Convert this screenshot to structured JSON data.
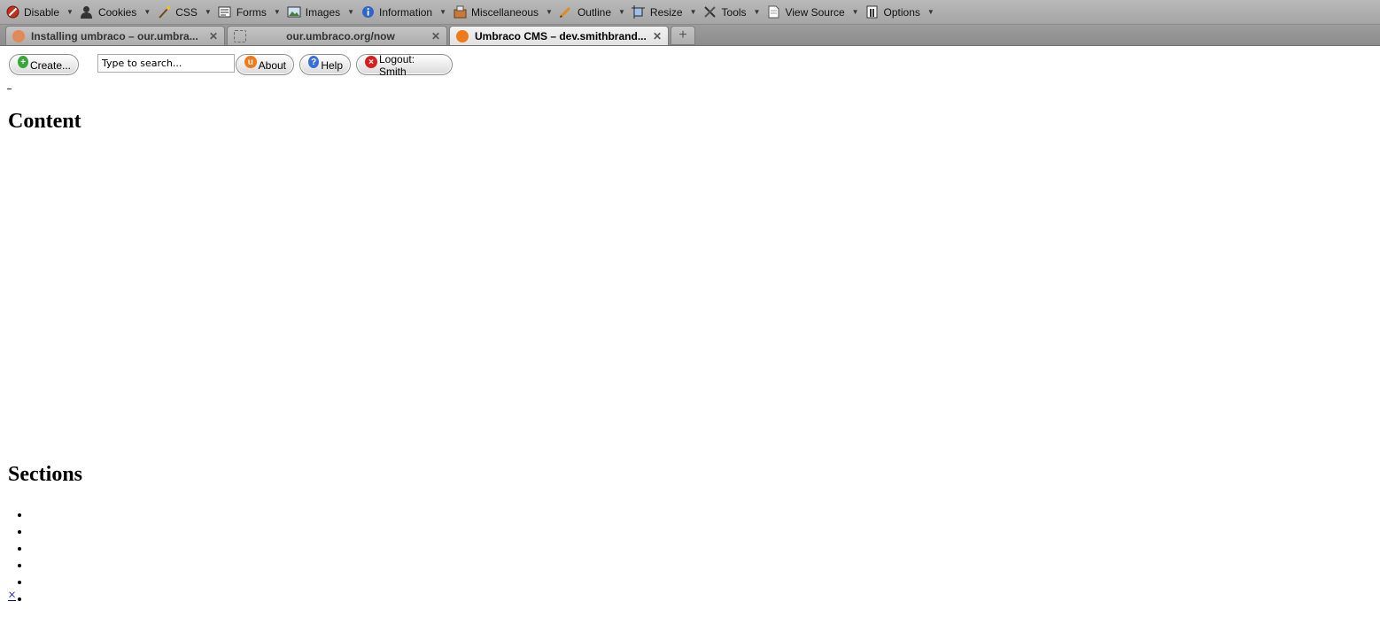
{
  "toolbar": {
    "items": [
      {
        "label": "Disable",
        "icon": "disable-icon"
      },
      {
        "label": "Cookies",
        "icon": "cookies-icon"
      },
      {
        "label": "CSS",
        "icon": "css-icon"
      },
      {
        "label": "Forms",
        "icon": "forms-icon"
      },
      {
        "label": "Images",
        "icon": "images-icon"
      },
      {
        "label": "Information",
        "icon": "information-icon"
      },
      {
        "label": "Miscellaneous",
        "icon": "miscellaneous-icon"
      },
      {
        "label": "Outline",
        "icon": "outline-icon"
      },
      {
        "label": "Resize",
        "icon": "resize-icon"
      },
      {
        "label": "Tools",
        "icon": "tools-icon"
      },
      {
        "label": "View Source",
        "icon": "view-source-icon"
      },
      {
        "label": "Options",
        "icon": "options-icon"
      }
    ]
  },
  "tabs": [
    {
      "title": "Installing umbraco – our.umbra...",
      "active": false
    },
    {
      "title": "our.umbraco.org/now",
      "active": false
    },
    {
      "title": "Umbraco CMS – dev.smithbrand...",
      "active": true
    }
  ],
  "page": {
    "create_label": "Create...",
    "search_placeholder": "Type to search...",
    "about_label": "About",
    "help_label": "Help",
    "logout_label": "Logout: Smith",
    "content_heading": "Content",
    "sections_heading": "Sections",
    "close_link": "×"
  },
  "colors": {
    "link": "#0000cc",
    "create_icon": "#3aa63a",
    "about_icon": "#f07a1a",
    "help_icon": "#3a6fd8",
    "logout_icon": "#d62020"
  }
}
